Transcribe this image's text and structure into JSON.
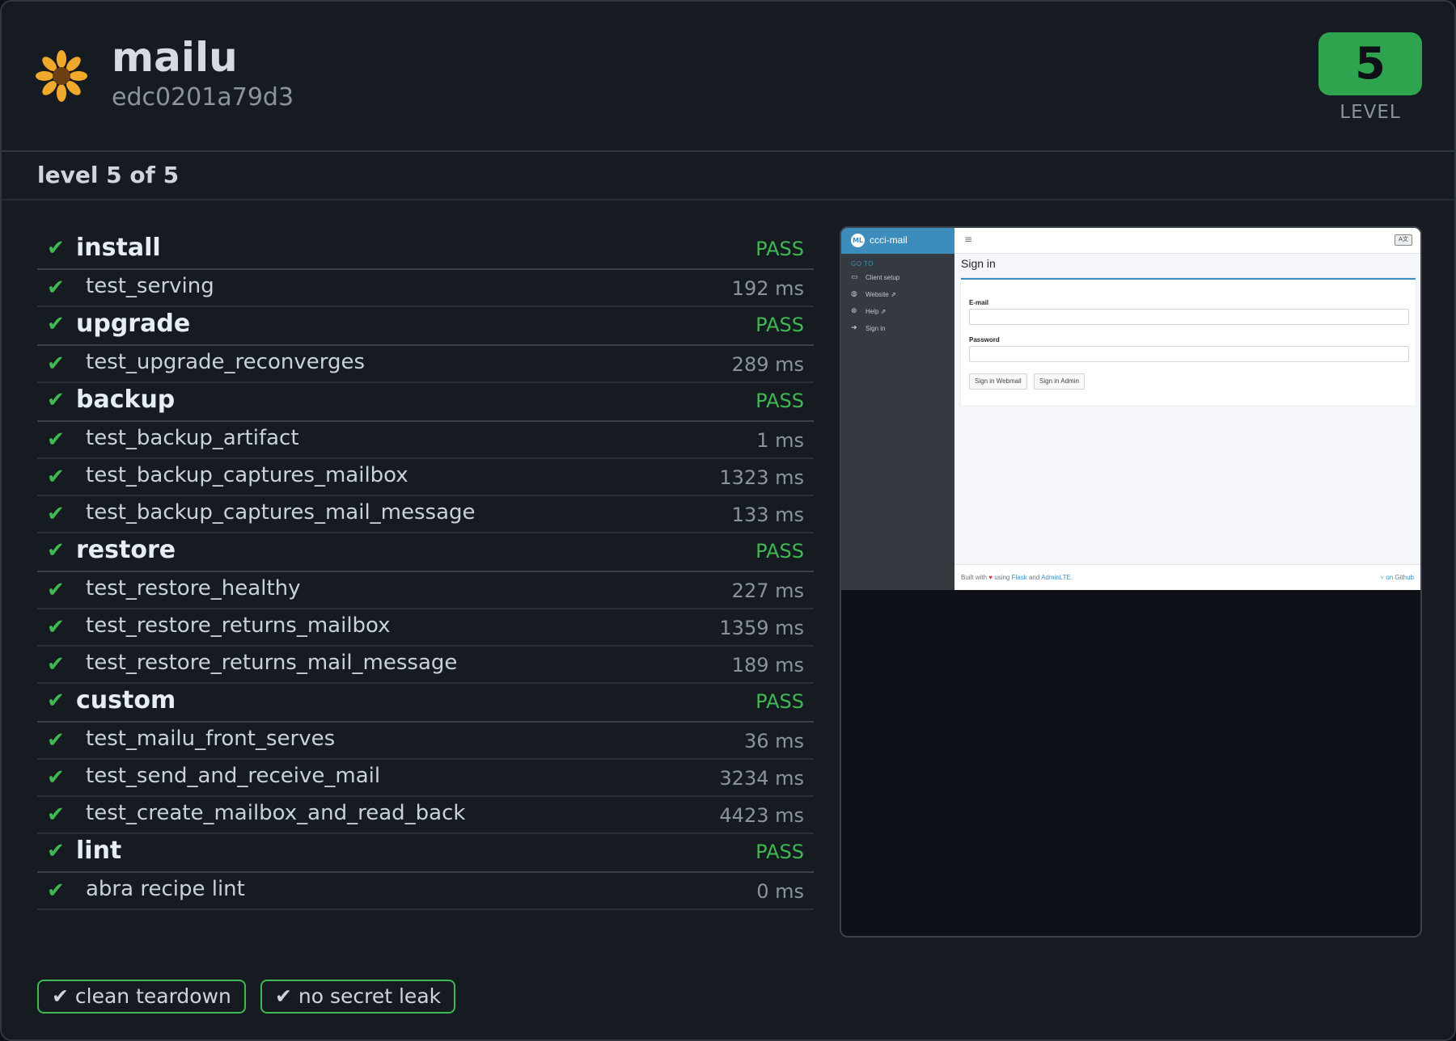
{
  "header": {
    "app_name": "mailu",
    "commit": "edc0201a79d3",
    "level_value": "5",
    "level_label": "LEVEL",
    "logo_icon": "sunflower-icon",
    "accent": "#2ea44f"
  },
  "subheader": {
    "level_text": "level 5 of 5"
  },
  "check_glyph": "✔",
  "groups": [
    {
      "name": "install",
      "status": "PASS",
      "tests": [
        {
          "name": "test_serving",
          "duration": "192 ms"
        }
      ]
    },
    {
      "name": "upgrade",
      "status": "PASS",
      "tests": [
        {
          "name": "test_upgrade_reconverges",
          "duration": "289 ms"
        }
      ]
    },
    {
      "name": "backup",
      "status": "PASS",
      "tests": [
        {
          "name": "test_backup_artifact",
          "duration": "1 ms"
        },
        {
          "name": "test_backup_captures_mailbox",
          "duration": "1323 ms"
        },
        {
          "name": "test_backup_captures_mail_message",
          "duration": "133 ms"
        }
      ]
    },
    {
      "name": "restore",
      "status": "PASS",
      "tests": [
        {
          "name": "test_restore_healthy",
          "duration": "227 ms"
        },
        {
          "name": "test_restore_returns_mailbox",
          "duration": "1359 ms"
        },
        {
          "name": "test_restore_returns_mail_message",
          "duration": "189 ms"
        }
      ]
    },
    {
      "name": "custom",
      "status": "PASS",
      "tests": [
        {
          "name": "test_mailu_front_serves",
          "duration": "36 ms"
        },
        {
          "name": "test_send_and_receive_mail",
          "duration": "3234 ms"
        },
        {
          "name": "test_create_mailbox_and_read_back",
          "duration": "4423 ms"
        }
      ]
    },
    {
      "name": "lint",
      "status": "PASS",
      "tests": [
        {
          "name": "abra recipe lint",
          "duration": "0 ms"
        }
      ]
    }
  ],
  "screenshot": {
    "brand_logo": "ML",
    "brand": "ccci-mail",
    "goto": "GO TO",
    "nav": [
      {
        "icon": "laptop-icon",
        "glyph": "▭",
        "label": "Client setup"
      },
      {
        "icon": "globe-icon",
        "glyph": "◍",
        "label": "Website ⇗"
      },
      {
        "icon": "lifebuoy-icon",
        "glyph": "⊗",
        "label": "Help ⇗"
      },
      {
        "icon": "sign-in-icon",
        "glyph": "➜",
        "label": "Sign in"
      }
    ],
    "menu_glyph": "≡",
    "lang_glyph": "A文",
    "title": "Sign in",
    "email_label": "E-mail",
    "password_label": "Password",
    "btn_webmail": "Sign in Webmail",
    "btn_admin": "Sign in Admin",
    "footer": {
      "built_with": "Built with",
      "heart": "♥",
      "using": "using",
      "flask": "Flask",
      "and": "and",
      "adminlte": "AdminLTE.",
      "github": "⑂ on Github"
    }
  },
  "badges": {
    "teardown": "✔ clean teardown",
    "secret": "✔ no secret leak"
  }
}
